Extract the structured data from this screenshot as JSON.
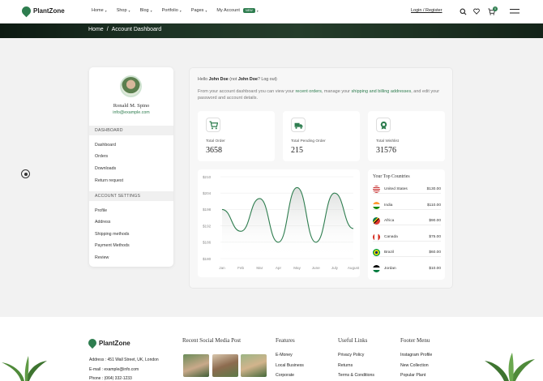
{
  "brand": {
    "name": "PlantZone"
  },
  "nav": {
    "items": [
      {
        "label": "Home",
        "chevron": true
      },
      {
        "label": "Shop",
        "chevron": true
      },
      {
        "label": "Blog",
        "chevron": true
      },
      {
        "label": "Portfolio",
        "chevron": true
      },
      {
        "label": "Pages",
        "chevron": true
      },
      {
        "label": "My Account",
        "chevron": true,
        "badge": "NEW"
      }
    ],
    "login_label": "Login / Register",
    "cart_count": "0",
    "icons": [
      "search-icon",
      "heart-icon",
      "cart-icon",
      "menu-icon"
    ]
  },
  "breadcrumb": {
    "home": "Home",
    "sep": "/",
    "current": "Account Dashboard"
  },
  "profile": {
    "name": "Ronald M. Spino",
    "email": "info@example.com"
  },
  "sidebar": {
    "dashboard_head": "DASHBOARD",
    "dashboard_items": [
      "Dashboard",
      "Orders",
      "Downloads",
      "Return request"
    ],
    "settings_head": "ACCOUNT SETTINGS",
    "settings_items": [
      "Profile",
      "Address",
      "Shipping methods",
      "Payment Methods",
      "Review"
    ]
  },
  "greeting": {
    "hello": "Hello",
    "name": "John Doe",
    "not": "(not",
    "name2": "John Doe",
    "logout": "? Log out)"
  },
  "description": {
    "part1": "From your account dashboard you can view your ",
    "link1": "recent orders",
    "part2": ", manage your ",
    "link2": "shipping and billing addresses",
    "part3": ", and edit your password and account details."
  },
  "stats": [
    {
      "label": "Total Order",
      "value": "3658",
      "icon": "cart-icon"
    },
    {
      "label": "Total Pending Order",
      "value": "215",
      "icon": "truck-icon"
    },
    {
      "label": "Total Wishlist",
      "value": "31576",
      "icon": "badge-icon"
    }
  ],
  "chart_data": {
    "type": "line",
    "categories": [
      "Jan",
      "Feb",
      "Mar",
      "Apr",
      "May",
      "June",
      "July",
      "August"
    ],
    "y_ticks": [
      "$210",
      "$204",
      "$198",
      "$192",
      "$186",
      "$180"
    ],
    "ylim": [
      180,
      210
    ],
    "values": [
      198,
      190,
      202,
      186,
      206,
      186,
      204,
      191
    ],
    "grid": true,
    "color": "#2e7d4f"
  },
  "countries": {
    "title": "Your Top Countries",
    "rows": [
      {
        "name": "United States",
        "value": "$130.00",
        "flag": "us"
      },
      {
        "name": "India",
        "value": "$110.00",
        "flag": "in"
      },
      {
        "name": "Africa",
        "value": "$90.00",
        "flag": "za"
      },
      {
        "name": "Canada",
        "value": "$75.00",
        "flag": "ca"
      },
      {
        "name": "Brazil",
        "value": "$60.00",
        "flag": "br"
      },
      {
        "name": "Jordan",
        "value": "$10.00",
        "flag": "jo"
      }
    ]
  },
  "footer": {
    "brand": "PlantZone",
    "address": "Address : 451 Wall Street, UK, London",
    "email": "E-mail : example@info.com",
    "phone": "Phone : (064) 332-1233",
    "social_title": "Recent Social Media Post",
    "col_features": {
      "title": "Features",
      "links": [
        "E-Money",
        "Local Business",
        "Corporate"
      ]
    },
    "col_useful": {
      "title": "Useful Links",
      "links": [
        "Privacy Policy",
        "Returns",
        "Terms & Conditions"
      ]
    },
    "col_menu": {
      "title": "Footer Menu",
      "links": [
        "Instagram Profile",
        "New Collection",
        "Popular Plant"
      ]
    }
  },
  "colors": {
    "accent": "#2e7d4f",
    "band": "#1d3325"
  }
}
